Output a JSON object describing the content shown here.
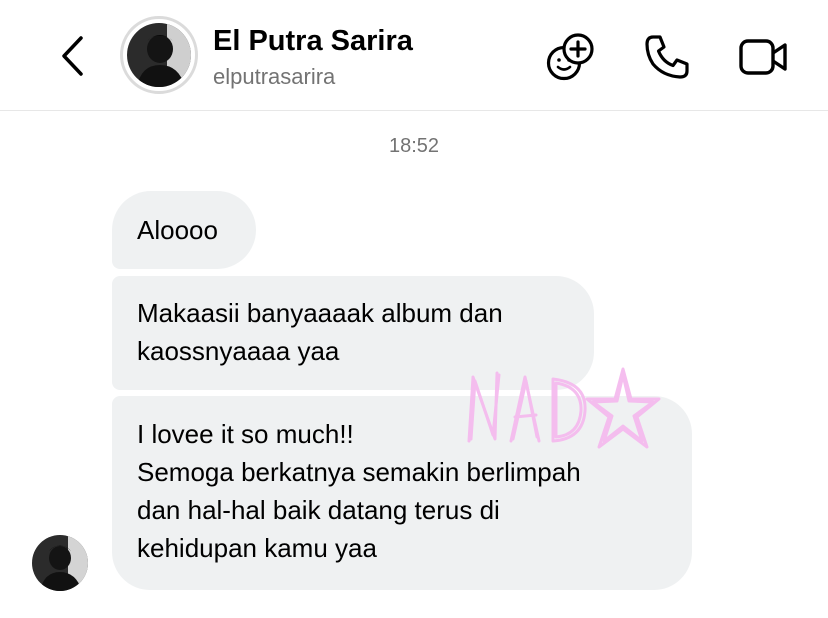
{
  "header": {
    "name": "El Putra Sarira",
    "username": "elputrasarira",
    "icons": {
      "back": "chevron-left-icon",
      "add_friend": "add-friend-icon",
      "call": "phone-icon",
      "video": "video-call-icon"
    }
  },
  "conversation": {
    "timestamp": "18:52",
    "messages": [
      {
        "lines": [
          "Aloooo"
        ]
      },
      {
        "lines": [
          "Makaasii banyaaaak album dan",
          "kaossnyaaaa yaa"
        ]
      },
      {
        "lines": [
          "I lovee it so much!!",
          "Semoga berkatnya semakin berlimpah",
          "dan hal-hal baik datang terus di",
          "kehidupan kamu yaa"
        ]
      }
    ]
  },
  "watermark": {
    "text": "NAD★",
    "color": "#f5b8ee"
  },
  "colors": {
    "bubble": "#eff1f2",
    "secondary_text": "#737373",
    "divider": "#e7e7e7"
  }
}
